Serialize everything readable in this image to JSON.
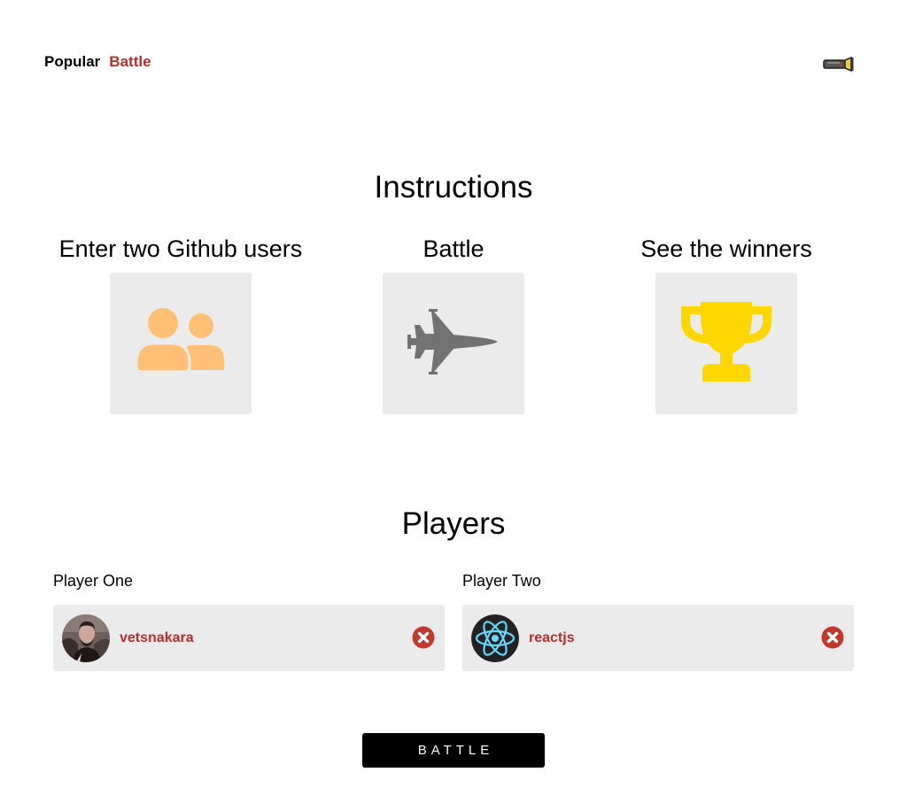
{
  "nav": {
    "items": [
      {
        "label": "Popular",
        "active": false
      },
      {
        "label": "Battle",
        "active": true
      }
    ],
    "theme_toggle_icon": "flashlight-icon"
  },
  "instructions": {
    "title": "Instructions",
    "steps": [
      {
        "label": "Enter two Github users",
        "icon": "users-icon",
        "color": "#ffbf74"
      },
      {
        "label": "Battle",
        "icon": "fighter-jet-icon",
        "color": "#727272"
      },
      {
        "label": "See the winners",
        "icon": "trophy-icon",
        "color": "#ffd700"
      }
    ]
  },
  "players": {
    "title": "Players",
    "one": {
      "label": "Player One",
      "username": "vetsnakara",
      "avatar": "user-photo-avatar"
    },
    "two": {
      "label": "Player Two",
      "username": "reactjs",
      "avatar": "react-logo-avatar"
    }
  },
  "battle_button": {
    "label": "BATTLE"
  },
  "colors": {
    "accent": "#b32e2e",
    "card_bg": "#ebebeb",
    "button_bg": "#000000"
  }
}
